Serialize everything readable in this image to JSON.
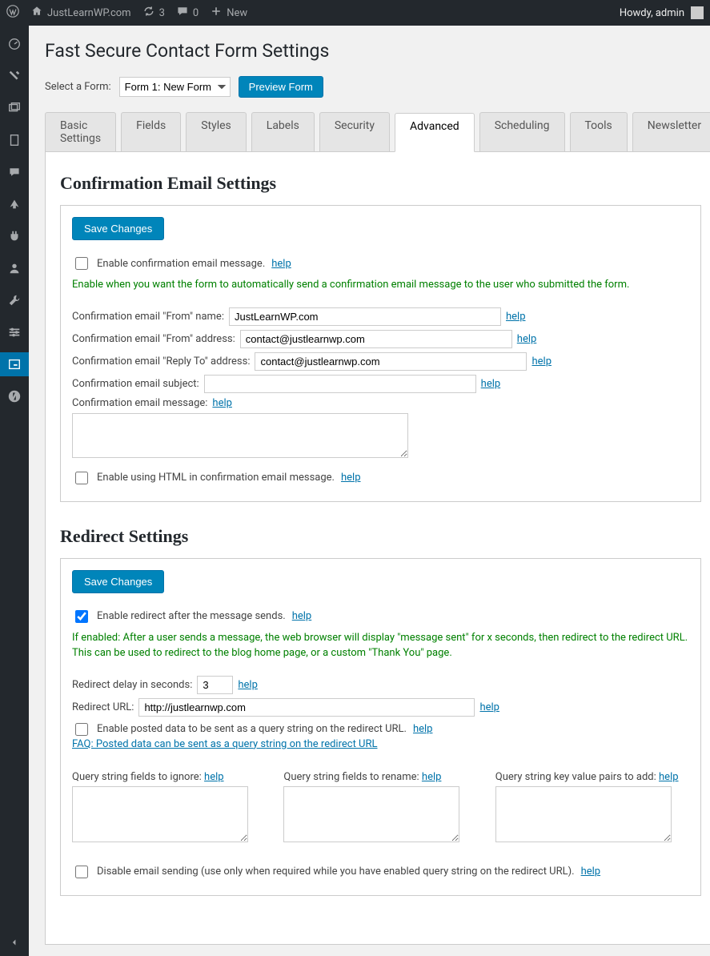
{
  "adminbar": {
    "site": "JustLearnWP.com",
    "updates": 3,
    "comments": 0,
    "new": "New",
    "howdy": "Howdy, admin"
  },
  "page": {
    "title": "Fast Secure Contact Form Settings",
    "select_label": "Select a Form:",
    "form_selected": "Form 1: New Form",
    "preview_btn": "Preview Form"
  },
  "tabs": [
    "Basic Settings",
    "Fields",
    "Styles",
    "Labels",
    "Security",
    "Advanced",
    "Scheduling",
    "Tools",
    "Newsletter"
  ],
  "confirm": {
    "heading": "Confirmation Email Settings",
    "save": "Save Changes",
    "enable_label": "Enable confirmation email message.",
    "enable_help": "Enable when you want the form to automatically send a confirmation email message to the user who submitted the form.",
    "from_name_label": "Confirmation email \"From\" name:",
    "from_name": "JustLearnWP.com",
    "from_addr_label": "Confirmation email \"From\" address:",
    "from_addr": "contact@justlearnwp.com",
    "reply_label": "Confirmation email \"Reply To\" address:",
    "reply": "contact@justlearnwp.com",
    "subject_label": "Confirmation email subject:",
    "subject": "",
    "message_label": "Confirmation email message:",
    "message": "",
    "html_label": "Enable using HTML in confirmation email message.",
    "help": "help"
  },
  "redirect": {
    "heading": "Redirect Settings",
    "save": "Save Changes",
    "enable_label": "Enable redirect after the message sends.",
    "enable_checked": true,
    "enable_help": "If enabled: After a user sends a message, the web browser will display \"message sent\" for x seconds, then redirect to the redirect URL. This can be used to redirect to the blog home page, or a custom \"Thank You\" page.",
    "delay_label": "Redirect delay in seconds:",
    "delay": "3",
    "url_label": "Redirect URL:",
    "url": "http://justlearnwp.com",
    "posted_label": "Enable posted data to be sent as a query string on the redirect URL.",
    "faq": "FAQ: Posted data can be sent as a query string on the redirect URL",
    "q_ignore_label": "Query string fields to ignore:",
    "q_rename_label": "Query string fields to rename:",
    "q_add_label": "Query string key value pairs to add:",
    "disable_email_label": "Disable email sending (use only when required while you have enabled query string on the redirect URL).",
    "help": "help"
  }
}
